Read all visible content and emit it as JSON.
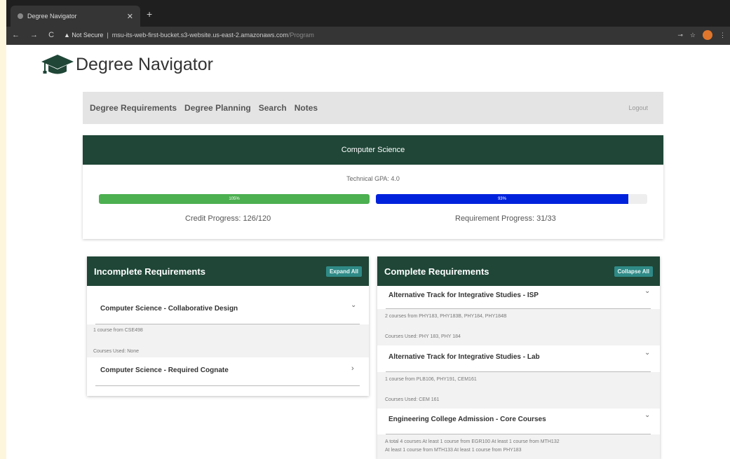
{
  "browser": {
    "tab_title": "Degree Navigator",
    "tab_close": "✕",
    "new_tab": "+",
    "nav_glyphs": "← → C",
    "security_label": "▲ Not Secure",
    "url_host": "msu-its-web-first-bucket.s3-website.us-east-2.amazonaws.com",
    "url_path": "/Program"
  },
  "brand": {
    "title": "Degree Navigator",
    "icon": "graduation-cap-icon"
  },
  "navbar": {
    "links": [
      "Degree Requirements",
      "Degree Planning",
      "Search",
      "Notes"
    ],
    "logout": "Logout"
  },
  "summary": {
    "program": "Computer Science",
    "gpa": "Technical GPA: 4.0",
    "credit_bar_text": "105%",
    "credit_fraction": 1.0,
    "requirement_bar_text": "93%",
    "requirement_fraction": 0.93,
    "credit_progress": "Credit Progress: 126/120",
    "requirement_progress": "Requirement Progress: 31/33"
  },
  "incomplete": {
    "title": "Incomplete Requirements",
    "button": "Expand All",
    "items": [
      {
        "name": "Computer Science - Collaborative Design",
        "chevron": "⌄",
        "detail": "1 course from CSE498",
        "used": "Courses Used: None"
      },
      {
        "name": "Computer Science - Required Cognate",
        "chevron": "›"
      }
    ]
  },
  "complete": {
    "title": "Complete Requirements",
    "button": "Collapse All",
    "items": [
      {
        "name": "Alternative Track for Integrative Studies - ISP",
        "chevron": "⌄",
        "detail": "2 courses from PHY183, PHY183B, PHY184, PHY184B",
        "used": "Courses Used: PHY 183, PHY 184"
      },
      {
        "name": "Alternative Track for Integrative Studies - Lab",
        "chevron": "⌄",
        "detail": "1 course from PLB106, PHY191, CEM161",
        "used": "Courses Used: CEM 161"
      },
      {
        "name": "Engineering College Admission - Core Courses",
        "chevron": "⌄",
        "detail": "A total 4 courses At least 1 course from EGR100 At least 1 course from MTH132",
        "detail2": "At least 1 course from MTH133 At least 1 course from PHY183"
      }
    ]
  },
  "colors": {
    "header_green": "#1f4637",
    "credit_bar": "#4caf50",
    "requirement_bar": "#0022dd",
    "button_teal": "#2f8a86"
  }
}
